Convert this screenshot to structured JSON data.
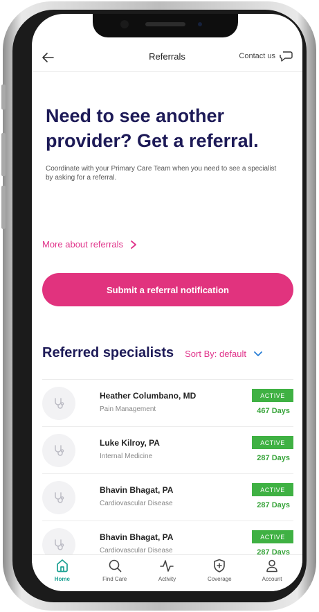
{
  "header": {
    "title": "Referrals",
    "contact_label": "Contact us"
  },
  "hero": {
    "title": "Need to see another provider? Get a referral.",
    "description": "Coordinate with your Primary Care Team when you need to see a specialist by asking for a referral."
  },
  "more_link": {
    "label": "More about referrals"
  },
  "submit_button": {
    "label": "Submit a referral notification"
  },
  "specialists": {
    "title": "Referred specialists",
    "sort_label": "Sort By: default",
    "items": [
      {
        "name": "Heather Columbano, MD",
        "specialty": "Pain Management",
        "status": "ACTIVE",
        "days": "467 Days"
      },
      {
        "name": "Luke Kilroy, PA",
        "specialty": "Internal Medicine",
        "status": "ACTIVE",
        "days": "287 Days"
      },
      {
        "name": "Bhavin Bhagat, PA",
        "specialty": "Cardiovascular Disease",
        "status": "ACTIVE",
        "days": "287 Days"
      },
      {
        "name": "Bhavin Bhagat, PA",
        "specialty": "Cardiovascular Disease",
        "status": "ACTIVE",
        "days": "287 Days"
      }
    ]
  },
  "tabs": [
    {
      "label": "Home",
      "icon": "home-icon",
      "active": true
    },
    {
      "label": "Find Care",
      "icon": "search-icon",
      "active": false
    },
    {
      "label": "Activity",
      "icon": "activity-icon",
      "active": false
    },
    {
      "label": "Coverage",
      "icon": "shield-plus-icon",
      "active": false
    },
    {
      "label": "Account",
      "icon": "person-icon",
      "active": false
    }
  ],
  "colors": {
    "primary_pink": "#e1337e",
    "navy": "#1d1a57",
    "active_green": "#3fb143",
    "tab_active": "#1aa092"
  }
}
